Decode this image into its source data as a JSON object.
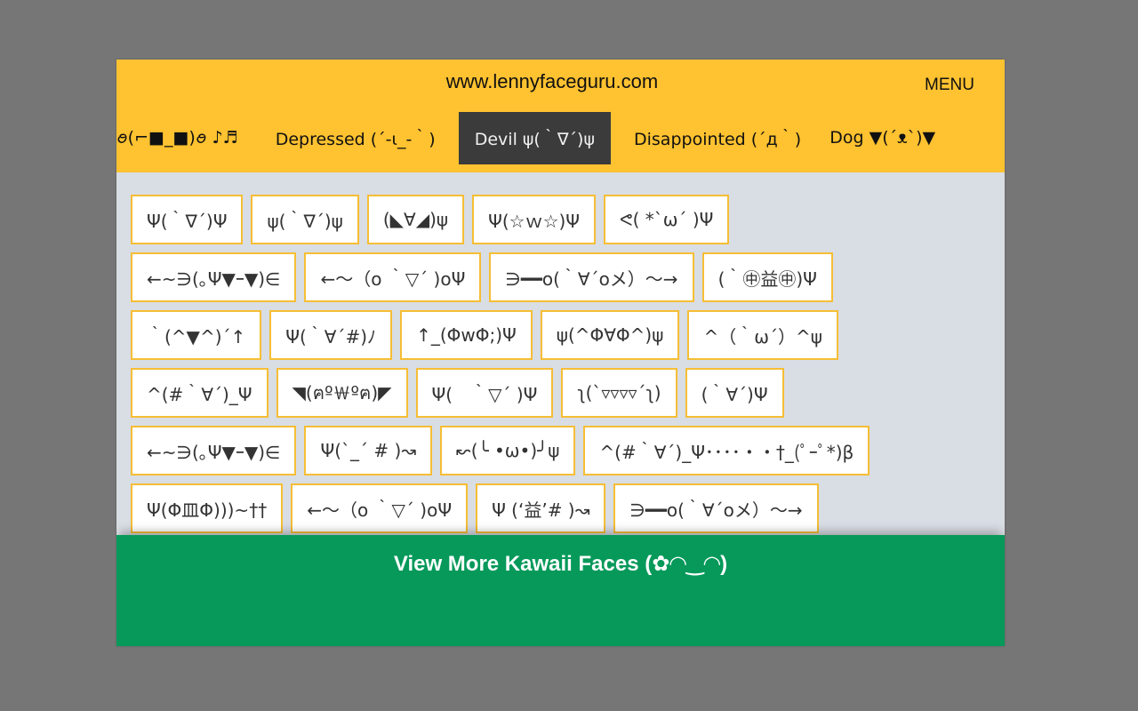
{
  "header": {
    "site_title": "www.lennyfaceguru.com",
    "menu_label": "MENU",
    "tabs": [
      "ꪮ(⌐■_■)ꪮ ♪♬",
      "Depressed (´-ι_-｀)",
      "Devil ψ(｀∇´)ψ",
      "Disappointed (´д｀)",
      "Dog ▼(´ᴥ`)▼"
    ],
    "active_tab_index": 2
  },
  "faces": {
    "rows": [
      [
        "Ψ(｀∇´)Ψ",
        "ψ(｀∇´)ψ",
        "(◣∀◢)ψ",
        "Ψ(☆ｗ☆)Ψ",
        "ᕙ( *`ω´ )Ψ"
      ],
      [
        "←~∋(｡Ψ▼ｰ▼)∈",
        "←～（o ｀▽´ )oΨ",
        "∋━━o(｀∀´oメ）～→",
        "(｀㊥益㊥)Ψ"
      ],
      [
        "｀(^▼^)´↑",
        "Ψ(｀∀´#)ﾉ",
        "↑_(ΦwΦ;)Ψ",
        "ψ(^Φ∀Φ^)ψ",
        "^（｀ω´）^ψ"
      ],
      [
        "^(#｀∀´)_Ψ",
        "◥(ฅº￦ºฅ)◤",
        "Ψ(　｀▽´ )Ψ",
        "ʅ(`▿▿▿▿´ʅ)",
        "(｀∀´)Ψ"
      ],
      [
        "←~∋(｡Ψ▼ｰ▼)∈",
        "Ψ(`_´ # )↝",
        "↜(╰ •ω•)╯ψ",
        "^(#｀∀´)_Ψ････・・†_(ﾟｰﾟ*)β"
      ],
      [
        "Ψ(Φ皿Φ)))~††",
        "←～（o ｀▽´ )oΨ",
        "Ψ (‘益’# )↝",
        "∋━━o(｀∀´oメ）～→"
      ]
    ]
  },
  "footer": {
    "view_more_label": "View More Kawaii Faces (✿◠‿◠)"
  },
  "colors": {
    "header_bg": "#ffc230",
    "active_tab_bg": "#3b3b3b",
    "face_border": "#f6be35",
    "content_bg": "#d9dde4",
    "footer_bg": "#06995a",
    "page_bg": "#767676"
  }
}
